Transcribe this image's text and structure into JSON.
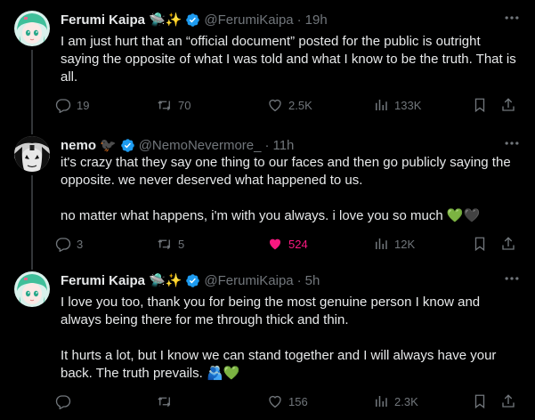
{
  "tweets": [
    {
      "name": "Ferumi Kaipa",
      "badge_emoji": "🛸✨",
      "handle": "@FerumiKaipa",
      "time": "19h",
      "paragraphs": [
        "I am just hurt that an “official document” posted for the public is outright saying the opposite of what I was told and what I know to be the truth. That is all."
      ],
      "replies": "19",
      "reposts": "70",
      "likes": "2.5K",
      "views": "133K",
      "liked": false
    },
    {
      "name": "nemo",
      "badge_emoji": "🐦‍⬛",
      "handle": "@NemoNevermore_",
      "time": "11h",
      "paragraphs": [
        "it's crazy that they say one thing to our faces and then go publicly saying the opposite. we never deserved what happened to us.",
        "no matter what happens, i'm with you always. i love you so much 💚🖤"
      ],
      "replies": "3",
      "reposts": "5",
      "likes": "524",
      "views": "12K",
      "liked": true
    },
    {
      "name": "Ferumi Kaipa",
      "badge_emoji": "🛸✨",
      "handle": "@FerumiKaipa",
      "time": "5h",
      "paragraphs": [
        "I love you too, thank you for being the most genuine person I know and always being there for me through thick and thin.",
        "It hurts a lot, but I know we can stand together and I will always have your back. The truth prevails. 🫂💚"
      ],
      "replies": "",
      "reposts": "",
      "likes": "156",
      "views": "2.3K",
      "liked": false
    }
  ],
  "separator": "·",
  "colors": {
    "background": "#000000",
    "text": "#e7e9ea",
    "muted": "#71767b",
    "verified": "#1d9bf0",
    "like": "#f91880",
    "divider": "#2f3336"
  }
}
